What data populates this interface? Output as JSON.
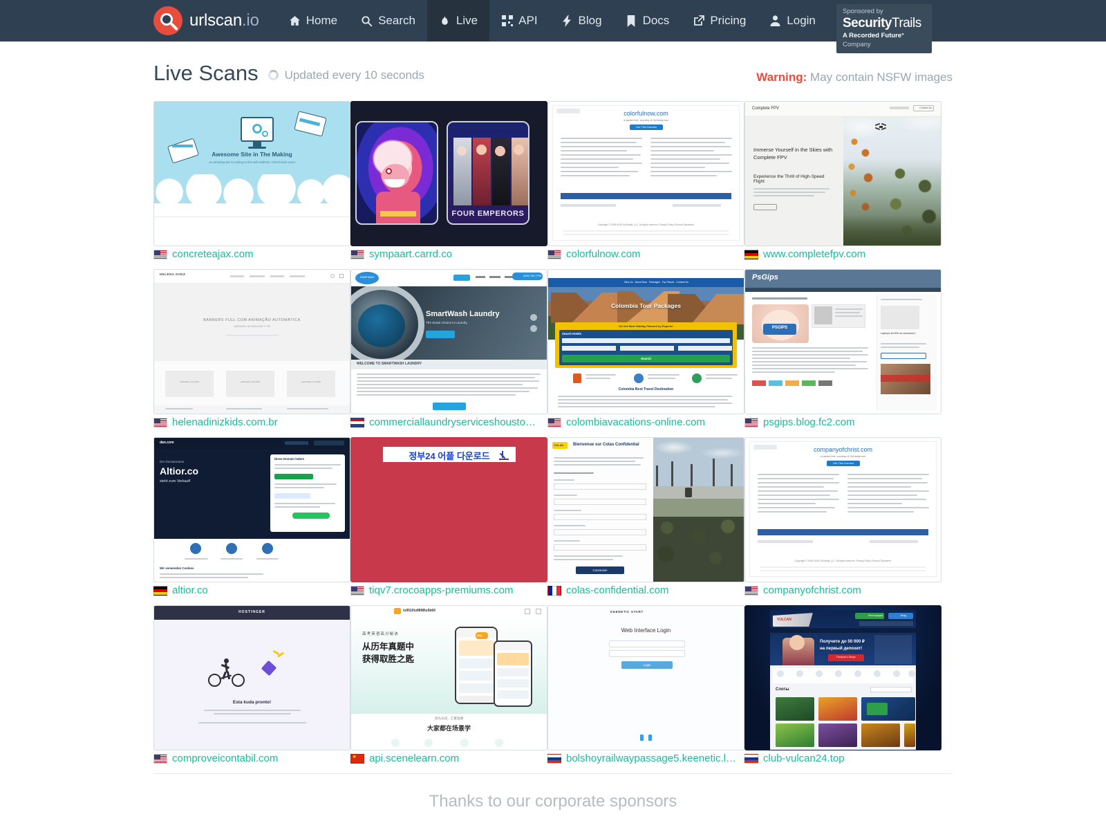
{
  "nav": {
    "brand": {
      "name": "urlscan",
      "tld": ".io"
    },
    "items": [
      {
        "label": "Home",
        "icon": "home-icon",
        "active": false
      },
      {
        "label": "Search",
        "icon": "search-icon",
        "active": false
      },
      {
        "label": "Live",
        "icon": "flame-icon",
        "active": true
      },
      {
        "label": "API",
        "icon": "qr-icon",
        "active": false
      },
      {
        "label": "Blog",
        "icon": "bolt-icon",
        "active": false
      },
      {
        "label": "Docs",
        "icon": "bookmark-icon",
        "active": false
      },
      {
        "label": "Pricing",
        "icon": "external-link-icon",
        "active": false
      },
      {
        "label": "Login",
        "icon": "user-icon",
        "active": false
      }
    ],
    "sponsor": {
      "line1": "Sponsored by",
      "brand_bold": "Security",
      "brand_light": "Trails",
      "line3_bold": "A Recorded Future°",
      "line3_rest": " Company"
    }
  },
  "header": {
    "title": "Live Scans",
    "subtitle": "Updated every 10 seconds",
    "warning_label": "Warning:",
    "warning_text": " May contain NSFW images"
  },
  "colors": {
    "navbar_bg": "#2f4052",
    "nav_active_bg": "#26333f",
    "link_green": "#1abc9c",
    "warning_red": "#e74c3c",
    "title_gray": "#34495e"
  },
  "scans": [
    {
      "domain": "concreteajax.com",
      "flag": "us",
      "kind": "awesome-site"
    },
    {
      "domain": "sympaart.carrd.co",
      "flag": "us",
      "kind": "carrd-art"
    },
    {
      "domain": "colorfulnow.com",
      "flag": "us",
      "kind": "godaddy-parked",
      "parked_domain": "colorfulnow.com"
    },
    {
      "domain": "www.completefpv.com",
      "flag": "de",
      "kind": "completefpv"
    },
    {
      "domain": "helenadinizkids.com.br",
      "flag": "us",
      "kind": "helena-diniz"
    },
    {
      "domain": "commerciallaundryserviceshouston.co...",
      "flag": "nl",
      "kind": "smartwash"
    },
    {
      "domain": "colombiavacations-online.com",
      "flag": "us",
      "kind": "colombia-tours"
    },
    {
      "domain": "psgips.blog.fc2.com",
      "flag": "us",
      "kind": "psgips-blog"
    },
    {
      "domain": "altior.co",
      "flag": "de",
      "kind": "dan-com"
    },
    {
      "domain": "tiqv7.crocoapps-premiums.com",
      "flag": "us",
      "kind": "korean-red"
    },
    {
      "domain": "colas-confidential.com",
      "flag": "fr",
      "kind": "colas-form"
    },
    {
      "domain": "companyofchrist.com",
      "flag": "us",
      "kind": "godaddy-parked",
      "parked_domain": "companyofchrist.com"
    },
    {
      "domain": "comproveicontabil.com",
      "flag": "us",
      "kind": "hostinger-cyclist"
    },
    {
      "domain": "api.scenelearn.com",
      "flag": "cn",
      "kind": "scenelearn"
    },
    {
      "domain": "bolshoyrailwaypassage5.keenetic.lin...",
      "flag": "ru",
      "kind": "web-interface-login"
    },
    {
      "domain": "club-vulcan24.top",
      "flag": "ru",
      "kind": "casino"
    }
  ],
  "thumb_text": {
    "awesome_title": "Awesome Site in The Making",
    "awesome_sub": "An amazing site is coming to this web address. Check back soon!",
    "carrd_caption": "FOUR EMPERORS",
    "godaddy_brand": "GoDaddy",
    "godaddy_sub": "is parked free, courtesy of GoDaddy.com",
    "godaddy_cta": "Get This Domain",
    "godaddy_copy": "Copyright © 1999-2025 GoDaddy, LLC. All rights reserved.  Privacy Policy  Product Disclaimer",
    "fpv_brand": "Complete FPV",
    "fpv_h1": "Immerse Yourself in the Skies with Complete FPV",
    "fpv_h2": "Experience the Thrill of High-Speed Flight",
    "fpv_cta": "Contact Us",
    "helena_brand": "HELENA DINIZ",
    "helena_banner": "BANNERS FULL COM ANIMAÇÃO AUTOMÁTICA",
    "helena_sub": "LARGURA / ALTURA  1920 X 700",
    "smartwash_brand": "SmartWash Laundry",
    "smartwash_tag": "The Smart Choice in Laundry",
    "smartwash_phone": "(346) 764-7796",
    "smartwash_welcome": "WELCOME TO SMARTWASH LAUNDRY",
    "colombia_h1": "Colombia Tour Packages",
    "colombia_bar": "Get the Best Holiday Planned by Experts!",
    "colombia_search": "Search Hotels",
    "colombia_btn": "Search",
    "colombia_h2": "Colombia Best Travel Destination",
    "psgips_brand": "PsGips",
    "psgips_ad": "Laptops für €99 an Anwohner!",
    "dan_brand": "dan.com",
    "dan_kicker": "Der Domainname",
    "dan_domain": "Altior.co",
    "dan_sub": "steht zum Verkauf!",
    "dan_box_title": "Diese Domain haben",
    "dan_section": "Wir verwenden Cookies",
    "korean_btn": "정부24 어플 다운로드",
    "colas_h1": "Bienvenue sur Colas Confidential",
    "colas_btn": "Connexion",
    "hostinger_brand": "HOSTINGER",
    "hostinger_title": "Esta kuda pronto!",
    "scenelearn_h1": "高考英语高分秘诀",
    "scenelearn_h2": "从历年真题中",
    "scenelearn_h3": "获得取胜之匙",
    "scenelearn_foot1": "高光光班，汇聚直播",
    "scenelearn_foot2": "大家都在场景学",
    "keenetic_brand": "KEENETIC START",
    "keenetic_title": "Web Interface Login",
    "keenetic_btn": "Login",
    "casino_bonus1": "Получите до 50 000 ₽",
    "casino_bonus2": "на первый депозит!",
    "casino_btn": "Получить бонус",
    "casino_section": "Слоты",
    "casino_reg": "Регистрация",
    "casino_login": "Вход"
  },
  "footer": {
    "title": "Thanks to our corporate sponsors"
  }
}
